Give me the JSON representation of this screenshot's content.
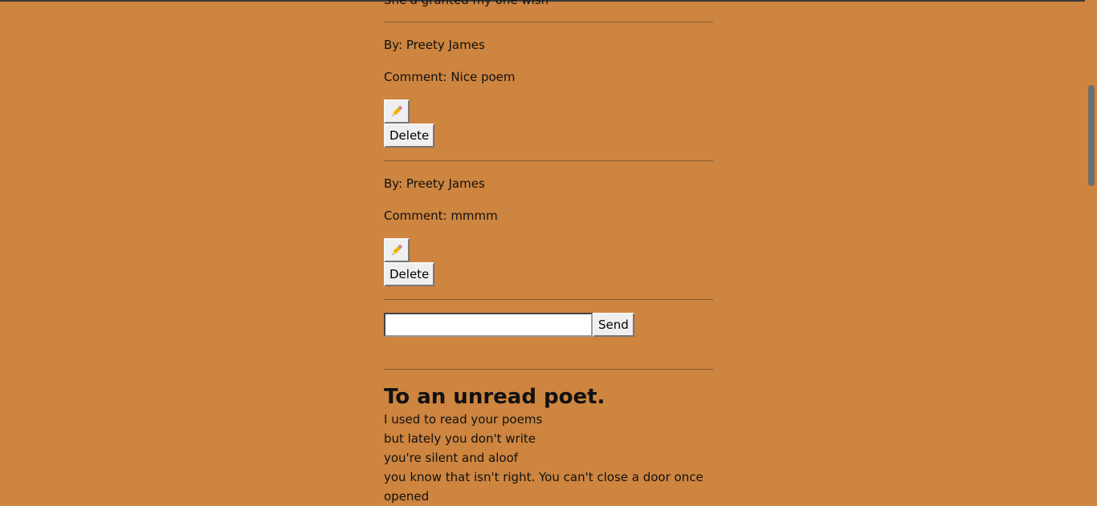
{
  "previous_poem": {
    "last_line": "She'd granted my one wish"
  },
  "comments": [
    {
      "author": "By: Preety James",
      "comment": "Comment: Nice poem",
      "delete_label": "Delete"
    },
    {
      "author": "By: Preety James",
      "comment": "Comment: mmmm",
      "delete_label": "Delete"
    }
  ],
  "comment_form": {
    "input_value": "",
    "send_label": "Send"
  },
  "poem": {
    "title": "To an unread poet.",
    "lines": [
      "I used to read your poems",
      "but lately you don't write",
      "you're silent and aloof",
      "you know that isn't right. You can't close a door once opened"
    ]
  },
  "colors": {
    "background": "#cd853f",
    "divider": "#8a5a2a"
  },
  "icons": {
    "edit": "pencil-icon"
  }
}
